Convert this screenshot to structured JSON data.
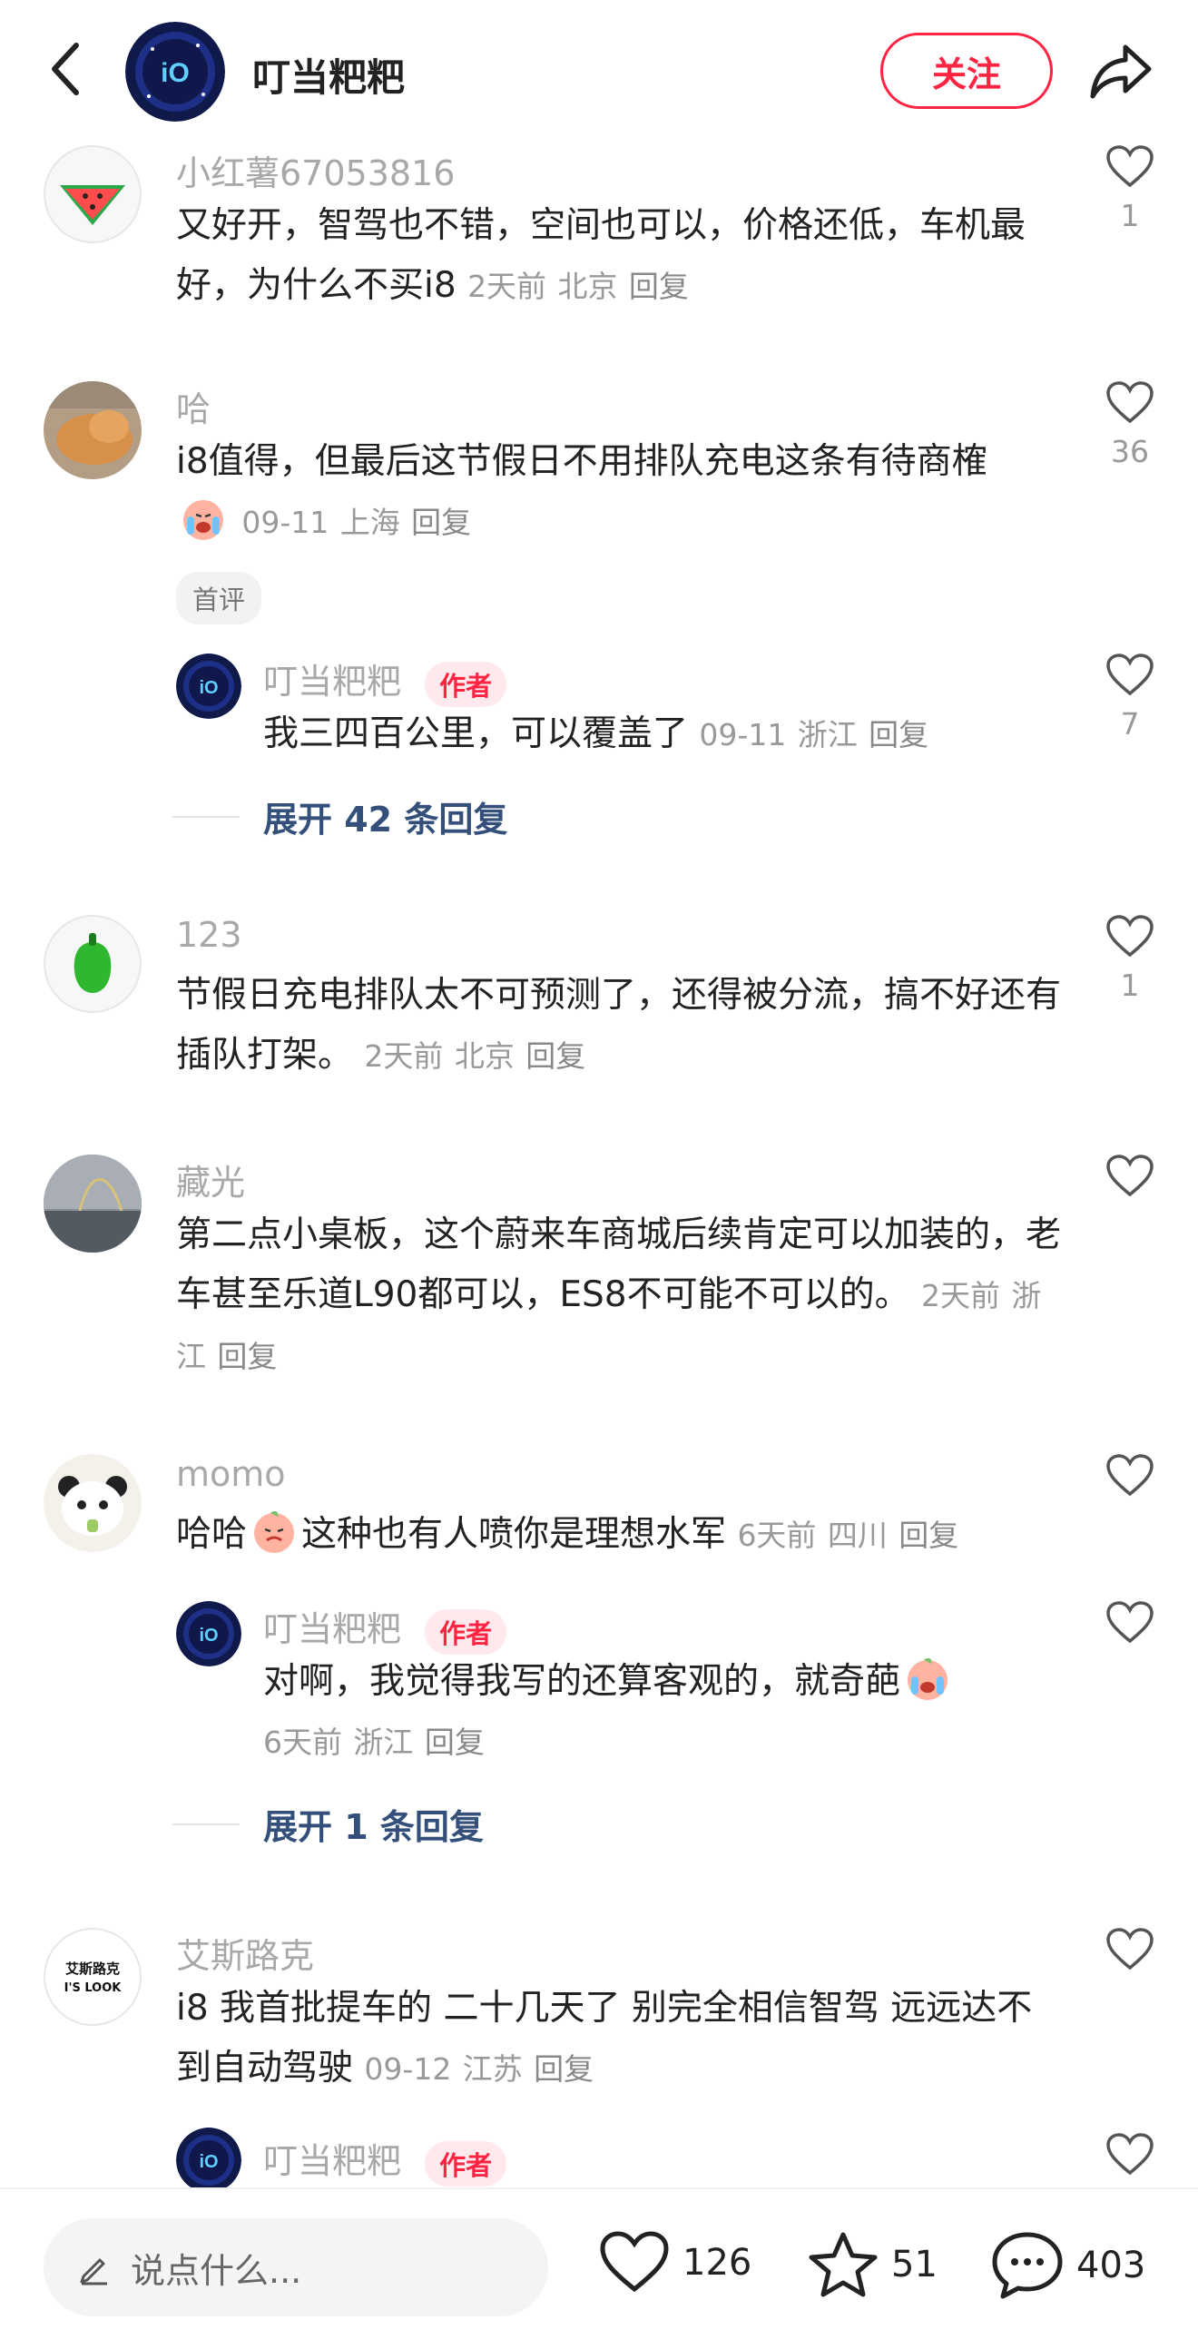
{
  "header": {
    "title": "叮当粑粑",
    "follow_label": "关注"
  },
  "comments": [
    {
      "username": "小红薯67053816",
      "text": "又好开，智驾也不错，空间也可以，价格还低，车机最好，为什么不买i8",
      "time": "2天前",
      "location": "北京",
      "reply_label": "回复",
      "likes": "1"
    },
    {
      "username": "哈",
      "text": "i8值得，但最后这节假日不用排队充电这条有待商榷",
      "time": "09-11",
      "location": "上海",
      "reply_label": "回复",
      "likes": "36",
      "badge": "首评",
      "reply": {
        "username": "叮当粑粑",
        "author_badge": "作者",
        "text": "我三四百公里，可以覆盖了",
        "time": "09-11",
        "location": "浙江",
        "reply_label": "回复",
        "likes": "7"
      },
      "expand_label": "展开 42 条回复"
    },
    {
      "username": "123",
      "text": "节假日充电排队太不可预测了，还得被分流，搞不好还有插队打架。",
      "time": "2天前",
      "location": "北京",
      "reply_label": "回复",
      "likes": "1"
    },
    {
      "username": "藏光",
      "text": "第二点小桌板，这个蔚来车商城后续肯定可以加装的，老车甚至乐道L90都可以，ES8不可能不可以的。",
      "time": "2天前",
      "location": "浙江",
      "reply_label": "回复",
      "likes": ""
    },
    {
      "username": "momo",
      "text_a": "哈哈",
      "text_b": "这种也有人喷你是理想水军",
      "time": "6天前",
      "location": "四川",
      "reply_label": "回复",
      "likes": "",
      "reply": {
        "username": "叮当粑粑",
        "author_badge": "作者",
        "text": "对啊，我觉得我写的还算客观的，就奇葩",
        "time": "6天前",
        "location": "浙江",
        "reply_label": "回复",
        "likes": ""
      },
      "expand_label": "展开 1 条回复"
    },
    {
      "username": "艾斯路克",
      "avatar_text_top": "艾斯路克",
      "avatar_text_bottom": "I'S LOOK",
      "text": "i8 我首批提车的 二十几天了 别完全相信智驾 远远达不到自动驾驶",
      "time": "09-12",
      "location": "江苏",
      "reply_label": "回复",
      "likes": "",
      "reply": {
        "username": "叮当粑粑",
        "author_badge": "作者"
      }
    }
  ],
  "bottom_bar": {
    "input_placeholder": "说点什么...",
    "likes": "126",
    "stars": "51",
    "comments": "403"
  },
  "colors": {
    "accent": "#ff2442",
    "link": "#34507a"
  }
}
